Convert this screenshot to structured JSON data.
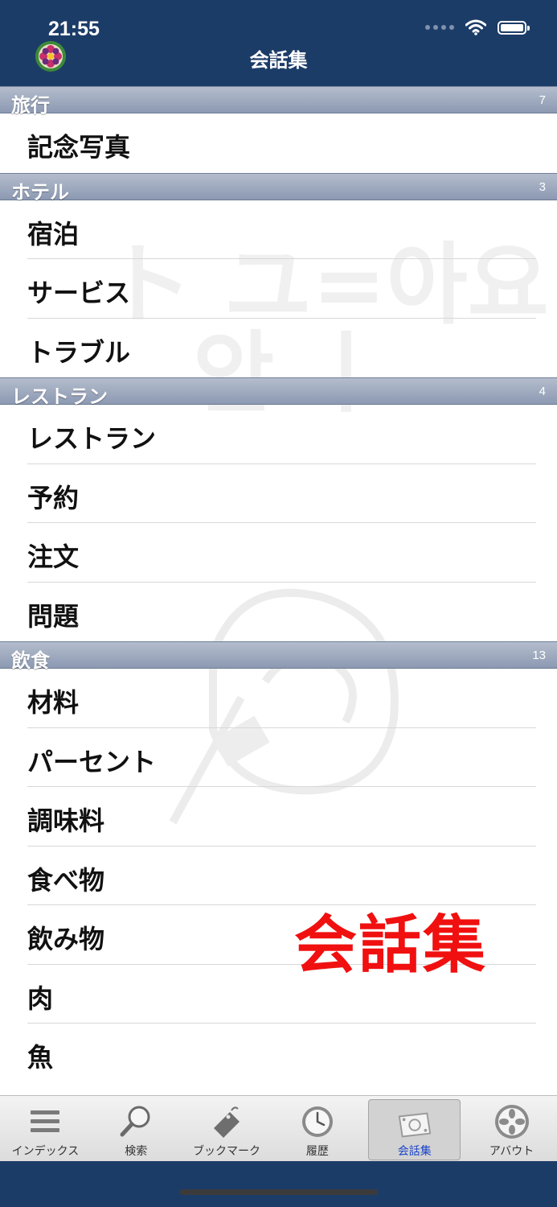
{
  "status": {
    "time": "21:55"
  },
  "nav": {
    "title": "会話集"
  },
  "sections": [
    {
      "title": "旅行",
      "count": "7",
      "items": [
        "記念写真"
      ]
    },
    {
      "title": "ホテル",
      "count": "3",
      "items": [
        "宿泊",
        "サービス",
        "トラブル"
      ]
    },
    {
      "title": "レストラン",
      "count": "4",
      "items": [
        "レストラン",
        "予約",
        "注文",
        "問題"
      ]
    },
    {
      "title": "飲食",
      "count": "13",
      "items": [
        "材料",
        "パーセント",
        "調味料",
        "食べ物",
        "飲み物",
        "肉",
        "魚"
      ]
    }
  ],
  "overlay_caption": "会話集",
  "tabs": [
    {
      "label": "インデックス",
      "icon": "list-icon",
      "active": false
    },
    {
      "label": "検索",
      "icon": "magnifier-icon",
      "active": false
    },
    {
      "label": "ブックマーク",
      "icon": "bookmark-tag-icon",
      "active": false
    },
    {
      "label": "履歴",
      "icon": "clock-icon",
      "active": false
    },
    {
      "label": "会話集",
      "icon": "conversation-icon",
      "active": true
    },
    {
      "label": "アバウト",
      "icon": "about-icon",
      "active": false
    }
  ],
  "colors": {
    "navbar": "#1c3c68",
    "active_tab_text": "#1b44c8",
    "caption": "#f01010"
  }
}
